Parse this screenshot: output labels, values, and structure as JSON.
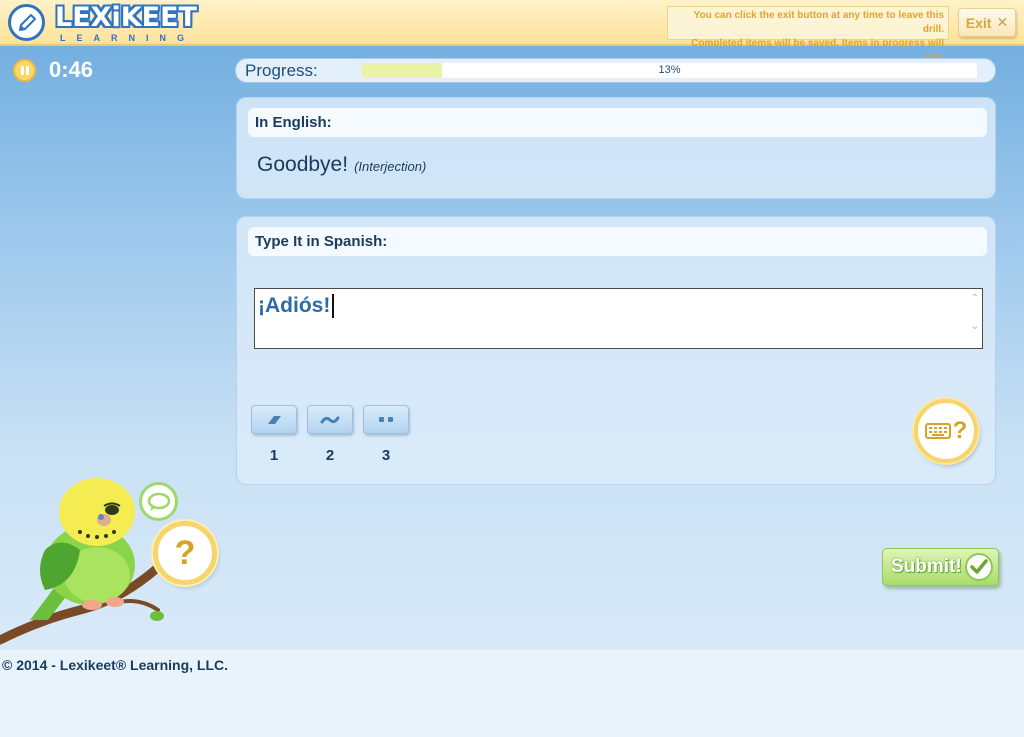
{
  "header": {
    "logo_text": "LEXiKEET",
    "logo_subtext": "LEARNING",
    "exit_notice_line1": "You can click the exit button at any time to leave this drill.",
    "exit_notice_line2": "Completed items will be saved. Items in progress will not.",
    "exit_label": "Exit",
    "exit_icon": "close-x-icon"
  },
  "timer": {
    "value": "0:46",
    "pause_icon": "pause-icon"
  },
  "progress": {
    "label": "Progress:",
    "percent_text": "13%",
    "fraction": 0.13
  },
  "english": {
    "heading": "In English:",
    "word": "Goodbye!",
    "part_of_speech": "(Interjection)"
  },
  "spanish": {
    "heading": "Type It in Spanish:",
    "answer": "¡Adiós!",
    "accent_buttons": [
      {
        "symbol": "´",
        "icon": "acute-accent-icon",
        "number": "1"
      },
      {
        "symbol": "~",
        "icon": "tilde-icon",
        "number": "2"
      },
      {
        "symbol": "¨",
        "icon": "umlaut-icon",
        "number": "3"
      }
    ],
    "keyboard_help_icon": "keyboard-help-icon",
    "keyboard_help_symbol": "?"
  },
  "help": {
    "symbol": "?",
    "chat_icon": "chat-bubble-icon"
  },
  "submit": {
    "label": "Submit!",
    "icon": "checkmark-icon"
  },
  "footer": {
    "copyright": "© 2014 - Lexikeet® Learning, LLC."
  },
  "colors": {
    "header_bg": "#fde29a",
    "brand_blue": "#2f74c0",
    "accent_yellow": "#f6d56a",
    "submit_green": "#a9dc6a",
    "text_dark": "#1a3b5d",
    "answer_blue": "#2d6aa8"
  }
}
